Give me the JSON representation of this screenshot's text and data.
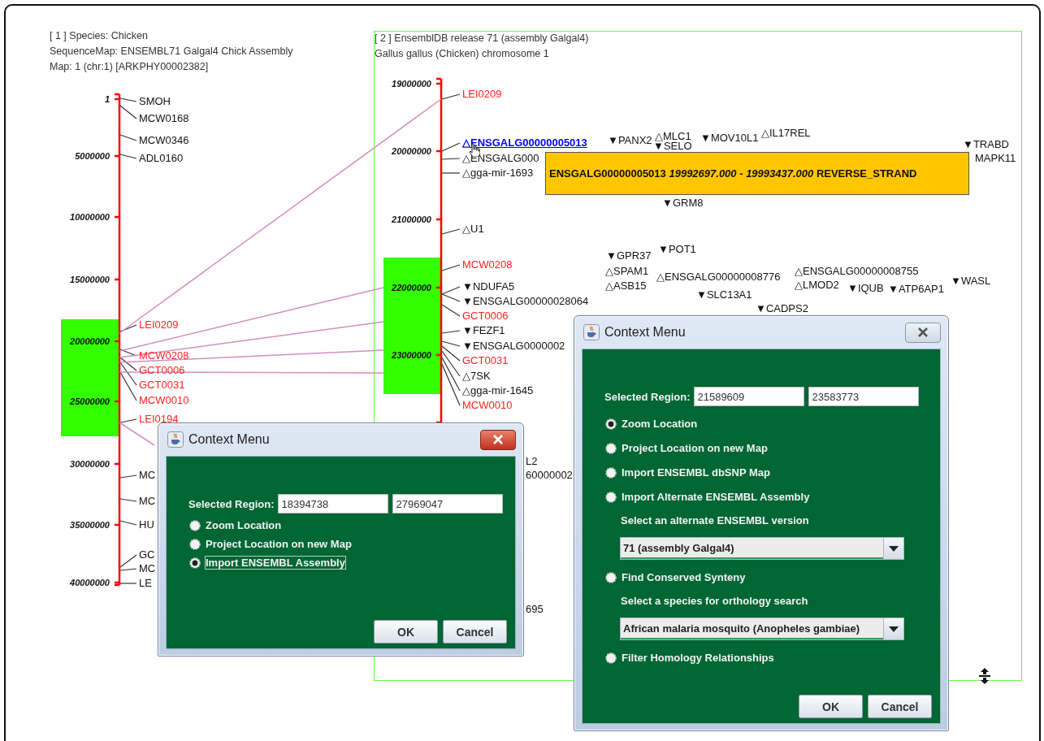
{
  "map_1": {
    "header": [
      "[ 1 ] Species: Chicken",
      "SequenceMap: ENSEMBL71 Galgal4 Chick Assembly",
      "Map: 1 (chr:1) [ARKPHY00002382]"
    ],
    "ticks": [
      "1",
      "5000000",
      "10000000",
      "15000000",
      "20000000",
      "25000000",
      "30000000",
      "35000000",
      "40000000"
    ],
    "markers": [
      {
        "label": "SMOH",
        "kind": "gene"
      },
      {
        "label": "MCW0168",
        "kind": "gene"
      },
      {
        "label": "MCW0346",
        "kind": "gene"
      },
      {
        "label": "ADL0160",
        "kind": "gene"
      },
      {
        "label": "LEI0209",
        "kind": "marker"
      },
      {
        "label": "MCW0208",
        "kind": "marker"
      },
      {
        "label": "GCT0006",
        "kind": "marker"
      },
      {
        "label": "GCT0031",
        "kind": "marker"
      },
      {
        "label": "MCW0010",
        "kind": "marker"
      },
      {
        "label": "LEI0194",
        "kind": "marker"
      },
      {
        "label": "MC",
        "kind": "gene"
      },
      {
        "label": "MC",
        "kind": "gene"
      },
      {
        "label": "HU",
        "kind": "gene"
      },
      {
        "label": "GC",
        "kind": "gene"
      },
      {
        "label": "MC",
        "kind": "gene"
      },
      {
        "label": "LE",
        "kind": "gene"
      }
    ]
  },
  "map_2": {
    "header": [
      "[ 2 ] EnsemblDB release 71 (assembly Galgal4)",
      "Gallus gallus (Chicken) chromosome 1"
    ],
    "ticks": [
      "19000000",
      "20000000",
      "21000000",
      "22000000",
      "23000000"
    ],
    "markers": [
      {
        "label": "LEI0209",
        "kind": "marker",
        "selected": false
      },
      {
        "glyph": "△",
        "label": "ENSGALG00000005013",
        "kind": "gene",
        "selected": true
      },
      {
        "glyph": "△",
        "label": "ENSGALG000",
        "kind": "gene",
        "selected": false
      },
      {
        "glyph": "△",
        "label": "gga-mir-1693",
        "kind": "gene",
        "selected": false
      },
      {
        "glyph": "△",
        "label": "U1",
        "kind": "gene",
        "selected": false
      },
      {
        "label": "MCW0208",
        "kind": "marker",
        "selected": false
      },
      {
        "glyph": "▼",
        "label": "NDUFA5",
        "kind": "gene",
        "selected": false
      },
      {
        "glyph": "▼",
        "label": "ENSGALG00000028064",
        "kind": "gene",
        "selected": false
      },
      {
        "label": "GCT0006",
        "kind": "marker",
        "selected": false
      },
      {
        "glyph": "▼",
        "label": "FEZF1",
        "kind": "gene",
        "selected": false
      },
      {
        "glyph": "▼",
        "label": "ENSGALG0000002",
        "kind": "gene",
        "selected": false
      },
      {
        "label": "GCT0031",
        "kind": "marker",
        "selected": false
      },
      {
        "glyph": "△",
        "label": "7SK",
        "kind": "gene",
        "selected": false
      },
      {
        "glyph": "△",
        "label": "gga-mir-1645",
        "kind": "gene",
        "selected": false
      },
      {
        "label": "MCW0010",
        "kind": "marker",
        "selected": false
      }
    ],
    "genes": [
      {
        "glyph": "▼",
        "label": "PANX2"
      },
      {
        "glyph": "△",
        "label": "MLC1"
      },
      {
        "glyph": "▼",
        "label": "SELO"
      },
      {
        "glyph": "▼",
        "label": "MOV10L1"
      },
      {
        "glyph": "△",
        "label": "IL17REL"
      },
      {
        "glyph": "▼",
        "label": "TRABD"
      },
      {
        "label": "MAPK11"
      },
      {
        "glyph": "▼",
        "label": "GRM8"
      },
      {
        "glyph": "▼",
        "label": "GPR37"
      },
      {
        "glyph": "▼",
        "label": "POT1"
      },
      {
        "glyph": "△",
        "label": "SPAM1"
      },
      {
        "glyph": "△",
        "label": "ASB15"
      },
      {
        "glyph": "△",
        "label": "ENSGALG00000008776"
      },
      {
        "glyph": "△",
        "label": "ENSGALG00000008755"
      },
      {
        "glyph": "△",
        "label": "LMOD2"
      },
      {
        "glyph": "▼",
        "label": "IQUB"
      },
      {
        "glyph": "▼",
        "label": "ATP6AP1"
      },
      {
        "glyph": "▼",
        "label": "WASL"
      },
      {
        "glyph": "▼",
        "label": "SLC13A1"
      },
      {
        "glyph": "▼",
        "label": "CADPS2"
      },
      {
        "label": "L2"
      },
      {
        "label": "60000002"
      },
      {
        "label": "695"
      }
    ]
  },
  "tooltip": {
    "text": "ENSGALG00000005013 *19992697.000 - 19993437.000* REVERSE_STRAND"
  },
  "dialogs": [
    {
      "title": "Context Menu",
      "active": true,
      "region_label": "Selected Region:",
      "region_start": "18394738",
      "region_end": "27969047",
      "options": [
        {
          "kind": "radio",
          "label": "Zoom Location",
          "selected": false
        },
        {
          "kind": "radio",
          "label": "Project Location on new Map",
          "selected": false
        },
        {
          "kind": "radio",
          "label": "Import ENSEMBL Assembly",
          "selected": true
        }
      ],
      "buttons": [
        "OK",
        "Cancel"
      ]
    },
    {
      "title": "Context Menu",
      "active": false,
      "region_label": "Selected Region:",
      "region_start": "21589609",
      "region_end": "23583773",
      "options": [
        {
          "kind": "radio",
          "label": "Zoom Location",
          "selected": true
        },
        {
          "kind": "radio",
          "label": "Project Location on new Map",
          "selected": false
        },
        {
          "kind": "radio",
          "label": "Import ENSEMBL dbSNP Map",
          "selected": false
        },
        {
          "kind": "radio",
          "label": "Import Alternate ENSEMBL Assembly",
          "selected": false
        },
        {
          "kind": "caption",
          "label": "Select an alternate ENSEMBL version"
        },
        {
          "kind": "dropdown",
          "value": "71 (assembly Galgal4)"
        },
        {
          "kind": "radio",
          "label": "Find Conserved Synteny",
          "selected": false
        },
        {
          "kind": "caption",
          "label": "Select a species for orthology search"
        },
        {
          "kind": "dropdown",
          "value": "African malaria mosquito (Anopheles gambiae)"
        },
        {
          "kind": "radio",
          "label": "Filter Homology Relationships",
          "selected": false
        }
      ],
      "buttons": [
        "OK",
        "Cancel"
      ]
    }
  ]
}
